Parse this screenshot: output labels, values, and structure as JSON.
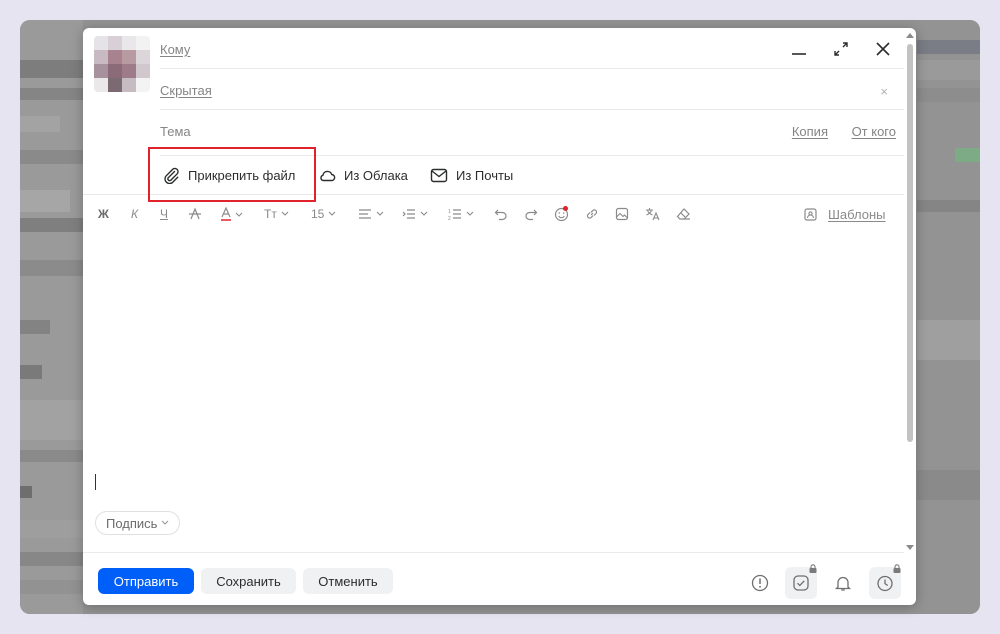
{
  "colors": {
    "accent": "#005ff9",
    "highlight": "#e0232c",
    "text_muted": "#858585"
  },
  "header": {
    "to_label": "Кому",
    "bcc_label": "Скрытая",
    "bcc_close": "×",
    "subject_label": "Тема",
    "cc_link": "Копия",
    "from_link": "От кого",
    "window_controls": [
      "minimize-icon",
      "expand-icon",
      "close-icon"
    ]
  },
  "attach": {
    "file": "Прикрепить файл",
    "cloud": "Из Облака",
    "mail": "Из Почты"
  },
  "toolbar": {
    "bold": "Ж",
    "italic": "К",
    "underline": "Ч",
    "text_style": "Тт",
    "font_size": "15",
    "templates": "Шаблоны",
    "icons": [
      "bold-icon",
      "italic-icon",
      "underline-icon",
      "strikethrough-icon",
      "text-color-icon",
      "text-style-icon",
      "font-size-icon",
      "align-icon",
      "indent-icon",
      "list-icon",
      "undo-icon",
      "redo-icon",
      "emoji-icon",
      "link-icon",
      "image-icon",
      "translate-icon",
      "clear-format-icon",
      "templates-icon"
    ]
  },
  "signature": {
    "label": "Подпись"
  },
  "footer": {
    "send": "Отправить",
    "save": "Сохранить",
    "cancel": "Отменить",
    "icons": [
      "important-icon",
      "receipt-icon",
      "reminder-icon",
      "schedule-icon"
    ]
  }
}
